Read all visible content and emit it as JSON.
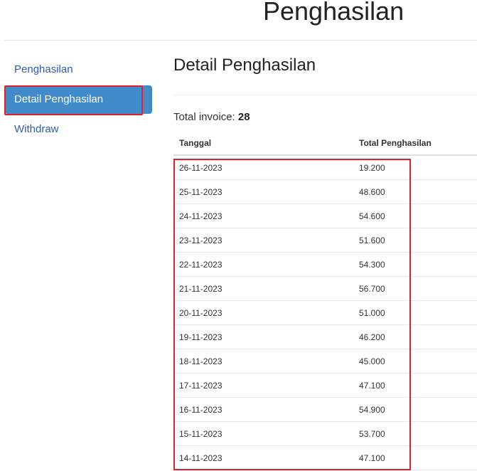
{
  "header": {
    "title": "Penghasilan"
  },
  "sidebar": {
    "items": [
      {
        "label": "Penghasilan"
      },
      {
        "label": "Detail Penghasilan"
      },
      {
        "label": "Withdraw"
      }
    ]
  },
  "content": {
    "title": "Detail Penghasilan",
    "total_label": "Total invoice: ",
    "total_value": "28"
  },
  "table": {
    "headers": [
      "Tanggal",
      "Total Penghasilan"
    ],
    "rows": [
      [
        "26-11-2023",
        "19.200"
      ],
      [
        "25-11-2023",
        "48.600"
      ],
      [
        "24-11-2023",
        "54.600"
      ],
      [
        "23-11-2023",
        "51.600"
      ],
      [
        "22-11-2023",
        "54.300"
      ],
      [
        "21-11-2023",
        "56.700"
      ],
      [
        "20-11-2023",
        "51.000"
      ],
      [
        "19-11-2023",
        "46.200"
      ],
      [
        "18-11-2023",
        "45.000"
      ],
      [
        "17-11-2023",
        "47.100"
      ],
      [
        "16-11-2023",
        "54.900"
      ],
      [
        "15-11-2023",
        "53.700"
      ],
      [
        "14-11-2023",
        "47.100"
      ]
    ]
  },
  "colors": {
    "accent": "#428bca",
    "highlight": "#e0202a",
    "link": "#2f5fa8"
  }
}
